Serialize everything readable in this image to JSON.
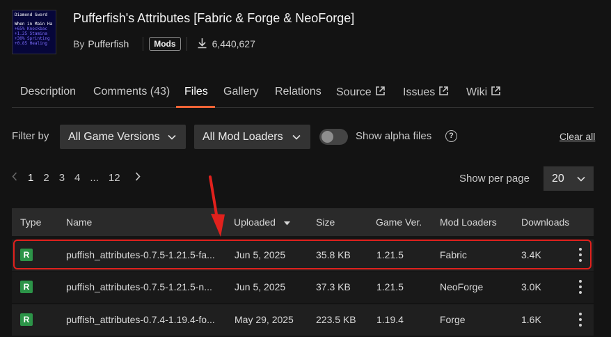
{
  "mod": {
    "thumbnail_lines": [
      "Diamond Sword",
      "When in Main Ha",
      "+65% Knockbac",
      "+1.25 Stamina",
      "+30% Sprinting",
      "+0.85 Healing"
    ],
    "title": "Pufferfish's Attributes [Fabric & Forge & NeoForge]",
    "by_label": "By",
    "author": "Pufferfish",
    "category_badge": "Mods",
    "downloads": "6,440,627"
  },
  "tabs": [
    {
      "label": "Description"
    },
    {
      "label": "Comments (43)"
    },
    {
      "label": "Files",
      "active": true
    },
    {
      "label": "Gallery"
    },
    {
      "label": "Relations"
    },
    {
      "label": "Source"
    },
    {
      "label": "Issues"
    },
    {
      "label": "Wiki"
    }
  ],
  "filters": {
    "label": "Filter by",
    "game_versions": "All Game Versions",
    "mod_loaders": "All Mod Loaders",
    "alpha_label": "Show alpha files",
    "help": "?",
    "clear": "Clear all"
  },
  "pagination": {
    "pages": [
      "1",
      "2",
      "3",
      "4",
      "...",
      "12"
    ],
    "current": "1",
    "per_page_label": "Show per page",
    "per_page": "20"
  },
  "table": {
    "headers": {
      "type": "Type",
      "name": "Name",
      "uploaded": "Uploaded",
      "size": "Size",
      "game_ver": "Game Ver.",
      "mod_loaders": "Mod Loaders",
      "downloads": "Downloads"
    },
    "rows": [
      {
        "type": "R",
        "name": "puffish_attributes-0.7.5-1.21.5-fa...",
        "uploaded": "Jun 5, 2025",
        "size": "35.8 KB",
        "game_ver": "1.21.5",
        "loader": "Fabric",
        "downloads": "3.4K"
      },
      {
        "type": "R",
        "name": "puffish_attributes-0.7.5-1.21.5-n...",
        "uploaded": "Jun 5, 2025",
        "size": "37.3 KB",
        "game_ver": "1.21.5",
        "loader": "NeoForge",
        "downloads": "3.0K"
      },
      {
        "type": "R",
        "name": "puffish_attributes-0.7.4-1.19.4-fo...",
        "uploaded": "May 29, 2025",
        "size": "223.5 KB",
        "game_ver": "1.19.4",
        "loader": "Forge",
        "downloads": "1.6K"
      }
    ]
  },
  "colors": {
    "accent": "#f16436",
    "release_badge": "#2c9448",
    "annotation": "#e1211d"
  }
}
